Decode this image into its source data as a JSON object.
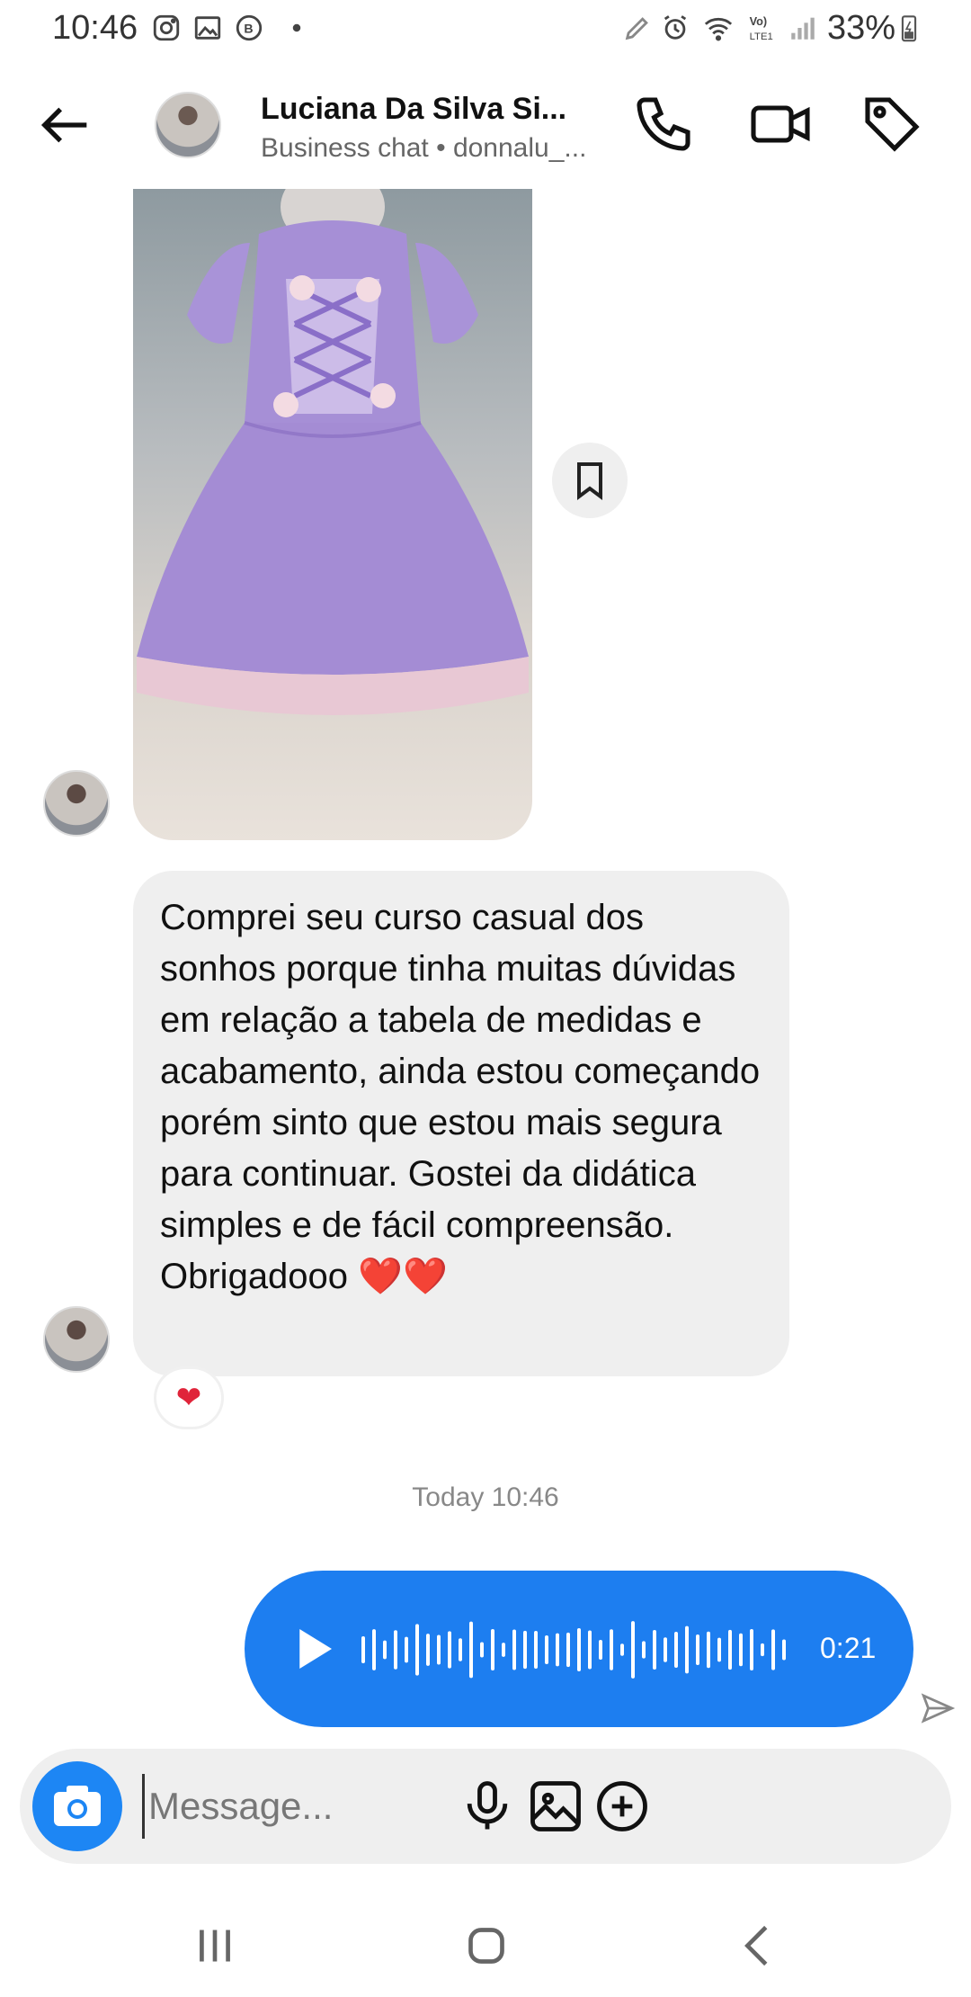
{
  "status_bar": {
    "time": "10:46",
    "battery": "33%",
    "network": "LTE1"
  },
  "header": {
    "title": "Luciana Da Silva Si...",
    "subtitle": "Business chat • donnalu_..."
  },
  "messages": {
    "received_text": "Comprei seu curso casual dos sonhos porque tinha muitas dúvidas em relação a tabela de medidas e acabamento, ainda estou começando porém sinto que estou mais segura para continuar. Gostei da didática simples e de fácil compreensão. Obrigadooo ❤️❤️",
    "reaction": "❤",
    "timestamp": "Today 10:46",
    "voice_duration": "0:21"
  },
  "composer": {
    "placeholder": "Message..."
  },
  "colors": {
    "accent_blue": "#1d7ef0",
    "bubble_gray": "#efefef",
    "heart_red": "#e0243a"
  },
  "icons": {
    "back": "arrow-left-icon",
    "call": "phone-icon",
    "video": "video-camera-icon",
    "tag": "tag-icon",
    "save": "bookmark-icon",
    "play": "play-icon",
    "sent": "send-icon",
    "camera": "camera-icon",
    "mic": "microphone-icon",
    "gallery": "image-icon",
    "add": "plus-circle-icon"
  }
}
